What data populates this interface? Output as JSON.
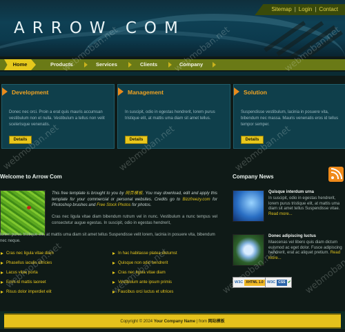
{
  "header": {
    "brand": "ARROW COM",
    "top_links": [
      "Sitemap",
      "Login",
      "Contact"
    ],
    "separator": "|"
  },
  "nav": {
    "items": [
      "Home",
      "Products",
      "Services",
      "Clients",
      "Company"
    ],
    "active": "Home"
  },
  "boxes": [
    {
      "title": "Development",
      "text": "Donec nec orci. Proin a erat quis mauris accumsan vestibulum non et nulla. Vestibulum a tellus non velit scelerisque venenatis.",
      "button": "Details"
    },
    {
      "title": "Management",
      "text": "In suscipit, odio in egestas hendrerit, lorem purus tristique elit, at mattis uma diam sit amet tellus.",
      "button": "Details"
    },
    {
      "title": "Solution",
      "text": "Suspendisse vestibulum, lacinia in posuere vita, bibendum nec massa. Mauris venenatis eros id tellus tempor semper.",
      "button": "Details"
    }
  ],
  "welcome": {
    "title": "Welcome to Arrow Com",
    "intro_1": "This free template is brought to you by ",
    "intro_link_1": "网页模板",
    "intro_2": ". You may download, edit and apply this template for your commercial or personal websites. Credits go to ",
    "intro_link_2": "Bizzfreezy.com",
    "intro_3": " for Photoshop brushes and ",
    "intro_link_3": "Free Stock Photos",
    "intro_4": " for photos.",
    "body_1": "Cras nec ligula vitae diam bibendum rutrum vel in nunc. Vestibulum a nunc tempus vel consectetur augue egestas. In suscipit, odio in egestas hendrerit,",
    "body_2": "lorem purus tristique elit, at mattis uma diam sit amet tellus Suspendisse velit lorem, lacinia in posuere vita, bibendum nec neque.",
    "list_left": [
      "Cras nec ligula vitae diam",
      "Phasellus iaculis ultricies",
      "Lacus vitae porta",
      "Enim id mattis laoreet",
      "Risus dolor imperdiet elit"
    ],
    "list_right": [
      "In hac habitasse platea dictumst",
      "Quisque non odio hendrerit",
      "Cras nec ligula vitae diam",
      "Vestibulum ante ipsum primis",
      "Faucibus orci luctus et ultrices"
    ]
  },
  "news": {
    "title": "Company News",
    "items": [
      {
        "heading": "Quisque interdum urna",
        "text": "In suscipit, odio in egestas hendrerit, lorem purus tristique elit, at mattis uma diam sit amet tellus Suspendisse vitae.",
        "more": "Read more..."
      },
      {
        "heading": "Donec adipiscing luctus",
        "text": "Maecenas vel libero quis diam dictum euismod ac eget dolor. Fusce adipiscing hendrerit, erat ac aliquet pretium.",
        "more": "Read more..."
      }
    ],
    "badges": [
      {
        "w3c": "W3C",
        "tag": "XHTML 1.0"
      },
      {
        "w3c": "W3C",
        "tag": "CSS"
      }
    ]
  },
  "footer": {
    "copyright": "Copyright © 2024 ",
    "company": "Your Company Name",
    "sep": " | from ",
    "source": "网站模板"
  },
  "watermark": "webmoban.net",
  "colors": {
    "accent": "#e5c81c",
    "orange": "#f2a422",
    "box_bg": "#0f3f4b",
    "nav": "#6a7a16"
  }
}
